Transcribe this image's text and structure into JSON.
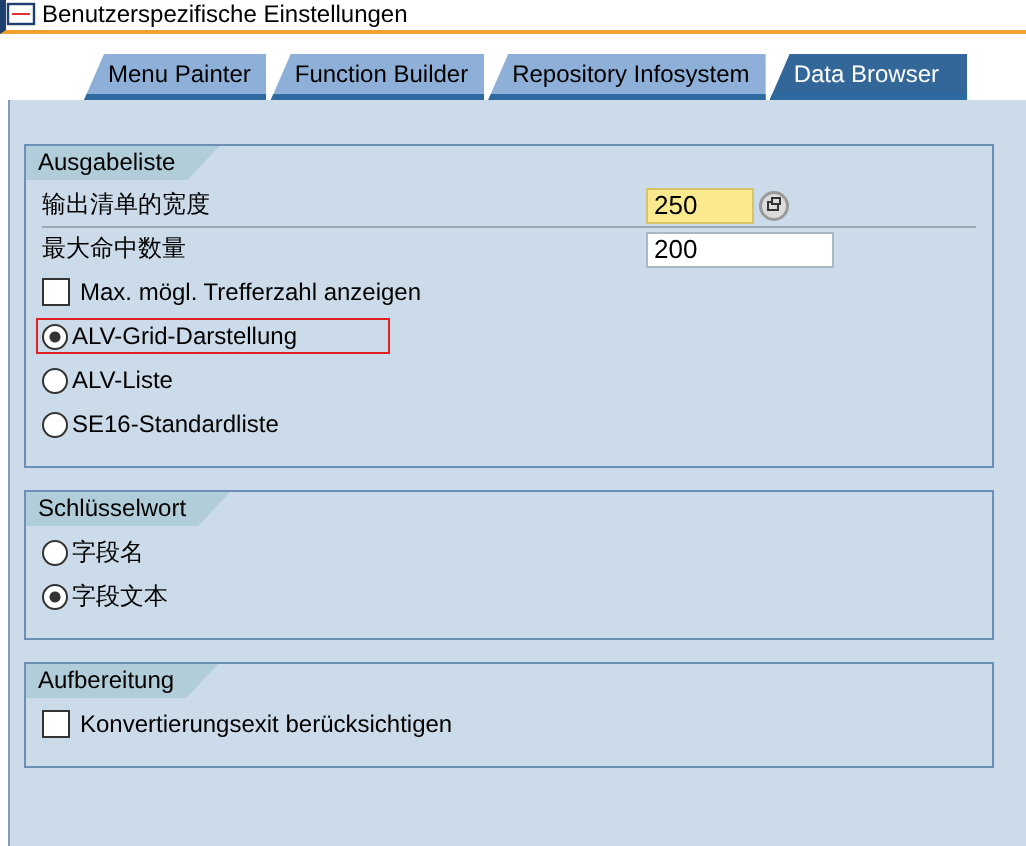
{
  "window": {
    "title": "Benutzerspezifische Einstellungen"
  },
  "tabs": [
    {
      "label": "Menu Painter",
      "selected": false
    },
    {
      "label": "Function Builder",
      "selected": false
    },
    {
      "label": "Repository Infosystem",
      "selected": false
    },
    {
      "label": "Data Browser",
      "selected": true
    }
  ],
  "groups": [
    {
      "title": "Ausgabeliste",
      "items": [
        {
          "kind": "field",
          "label": "输出清单的宽度",
          "value": "250",
          "focused": true,
          "help_button": true
        },
        {
          "kind": "field",
          "label": "最大命中数量",
          "value": "200",
          "focused": false,
          "help_button": false
        },
        {
          "kind": "checkbox",
          "label": "Max. mögl. Trefferzahl anzeigen",
          "checked": false
        },
        {
          "kind": "radio",
          "label": "ALV-Grid-Darstellung",
          "selected": true,
          "focused": true
        },
        {
          "kind": "radio",
          "label": "ALV-Liste",
          "selected": false,
          "focused": false
        },
        {
          "kind": "radio",
          "label": "SE16-Standardliste",
          "selected": false,
          "focused": false
        }
      ]
    },
    {
      "title": "Schlüsselwort",
      "items": [
        {
          "kind": "radio",
          "label": "字段名",
          "selected": false,
          "focused": false
        },
        {
          "kind": "radio",
          "label": "字段文本",
          "selected": true,
          "focused": false
        }
      ]
    },
    {
      "title": "Aufbereitung",
      "items": [
        {
          "kind": "checkbox",
          "label": "Konvertierungsexit berücksichtigen",
          "checked": false
        }
      ]
    }
  ]
}
